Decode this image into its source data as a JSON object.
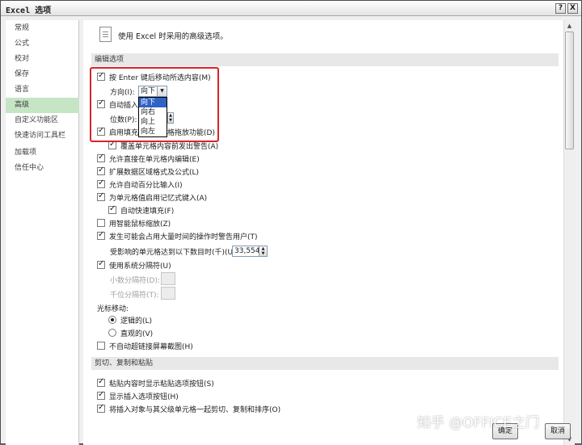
{
  "window": {
    "title": "Excel 选项",
    "help": "?",
    "close": "X"
  },
  "sidebar": {
    "items": [
      "常规",
      "公式",
      "校对",
      "保存",
      "语言",
      "高级",
      "自定义功能区",
      "快速访问工具栏",
      "加载项",
      "信任中心"
    ],
    "selected": "高级"
  },
  "intro": "使用 Excel 时采用的高级选项。",
  "sections": {
    "edit": "编辑选项",
    "cut": "剪切、复制和粘贴"
  },
  "edit_options": {
    "enter_move": "按 Enter 键后移动所选内容(M)",
    "direction_label": "方向(I):",
    "direction_value": "向下",
    "direction_options": [
      "向下",
      "向右",
      "向上",
      "向左"
    ],
    "auto_insert": "自动插入",
    "digits_label": "位数(P):",
    "fill_handle_left": "启用填充",
    "fill_handle_right": "格拖放功能(D)",
    "overwrite_warn": "覆盖单元格内容前发出警告(A)",
    "direct_edit": "允许直接在单元格内编辑(E)",
    "extend_formats": "扩展数据区域格式及公式(L)",
    "auto_percent": "允许自动百分比输入(I)",
    "autocomplete": "为单元格值启用记忆式键入(A)",
    "flash_fill": "自动快速填充(F)",
    "zoom_roll": "用智能鼠标缩放(Z)",
    "alert_slow": "发生可能会占用大量时间的操作时警告用户(T)",
    "cells_affected_label": "受影响的单元格达到以下数目时(千)(U):",
    "cells_affected_value": "33,554",
    "system_separators": "使用系统分隔符(U)",
    "decimal_sep": "小数分隔符(D):",
    "thousands_sep": "千位分隔符(T):",
    "cursor_move": "光标移动:",
    "logical": "逻辑的(L)",
    "visual": "直观的(V)",
    "no_auto_hyperlink": "不自动超链接屏幕截图(H)"
  },
  "cut_options": {
    "paste_button": "粘贴内容时显示粘贴选项按钮(S)",
    "insert_button": "显示插入选项按钮(H)",
    "sort_with_parent": "将插入对象与其父级单元格一起剪切、复制和排序(O)"
  },
  "buttons": {
    "ok": "确定",
    "cancel": "取消"
  },
  "watermark": "知乎 @OFFICE之门"
}
